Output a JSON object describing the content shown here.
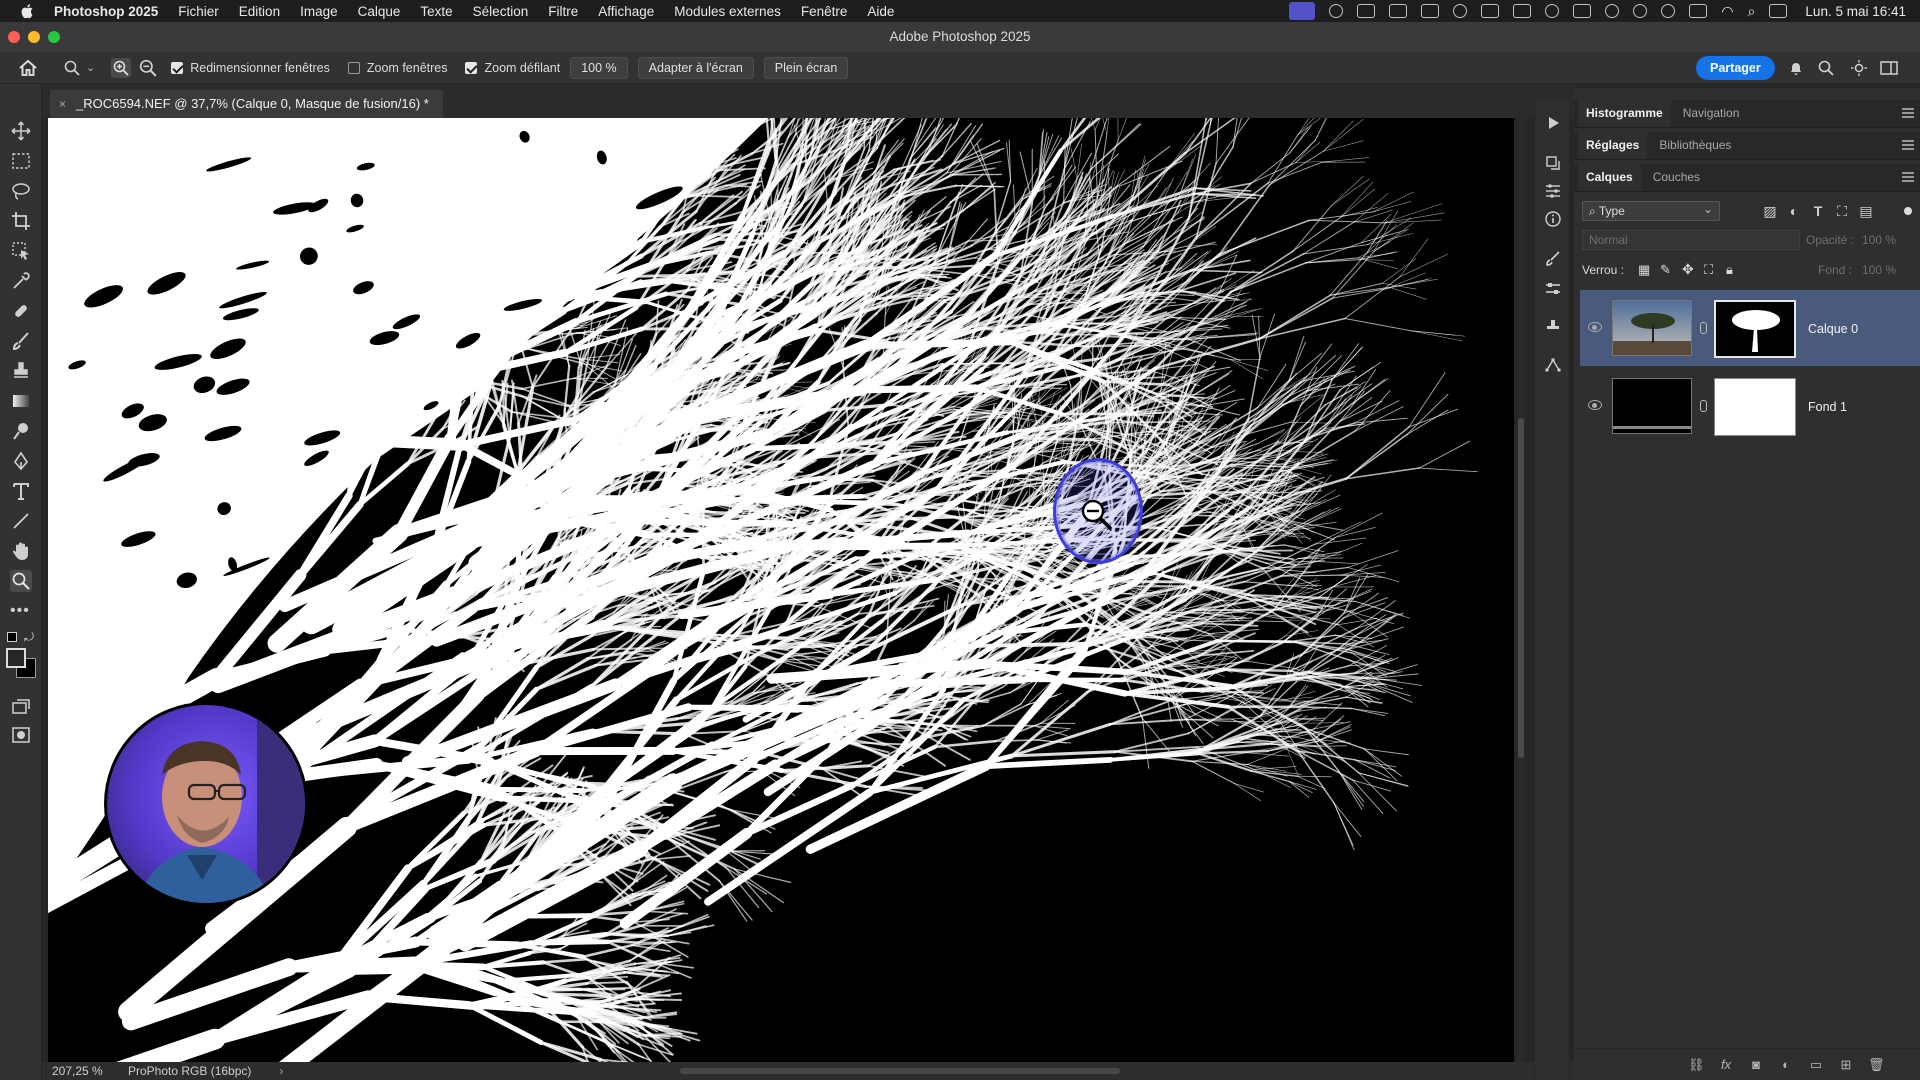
{
  "menubar": {
    "app_name": "Photoshop 2025",
    "menus": [
      "Fichier",
      "Edition",
      "Image",
      "Calque",
      "Texte",
      "Sélection",
      "Filtre",
      "Affichage",
      "Modules externes",
      "Fenêtre",
      "Aide"
    ],
    "clock": "Lun. 5 mai  16:41"
  },
  "window": {
    "title": "Adobe Photoshop 2025"
  },
  "options_bar": {
    "resize_windows": {
      "label": "Redimensionner fenêtres",
      "checked": true
    },
    "zoom_all": {
      "label": "Zoom fenêtres",
      "checked": false
    },
    "scrubby_zoom": {
      "label": "Zoom défilant",
      "checked": true
    },
    "zoom_value": "100 %",
    "fit_screen": "Adapter à l'écran",
    "fill_screen": "Plein écran",
    "share": "Partager"
  },
  "document": {
    "tab_title": "_ROC6594.NEF @ 37,7% (Calque 0, Masque de fusion/16) *",
    "close_glyph": "×"
  },
  "status": {
    "zoom": "207,25 %",
    "profile": "ProPhoto RGB (16bpc)",
    "arrow": "›"
  },
  "panels": {
    "group1": {
      "tabs": [
        "Histogramme",
        "Navigation"
      ]
    },
    "group2": {
      "tabs": [
        "Réglages",
        "Bibliothèques"
      ]
    },
    "group3": {
      "tabs": [
        "Calques",
        "Couches"
      ]
    },
    "filter_type": "Type",
    "blend_mode": "Normal",
    "opacity_label": "Opacité :",
    "opacity_value": "100 %",
    "lock_label": "Verrou :",
    "fill_label": "Fond :",
    "fill_value": "100 %",
    "layers": [
      {
        "name": "Calque 0",
        "selected": true
      },
      {
        "name": "Fond 1",
        "selected": false
      }
    ]
  },
  "colors": {
    "accent": "#1473e6",
    "selected_layer": "#4a5a7c",
    "menubar_active": "#5e5ce6"
  }
}
